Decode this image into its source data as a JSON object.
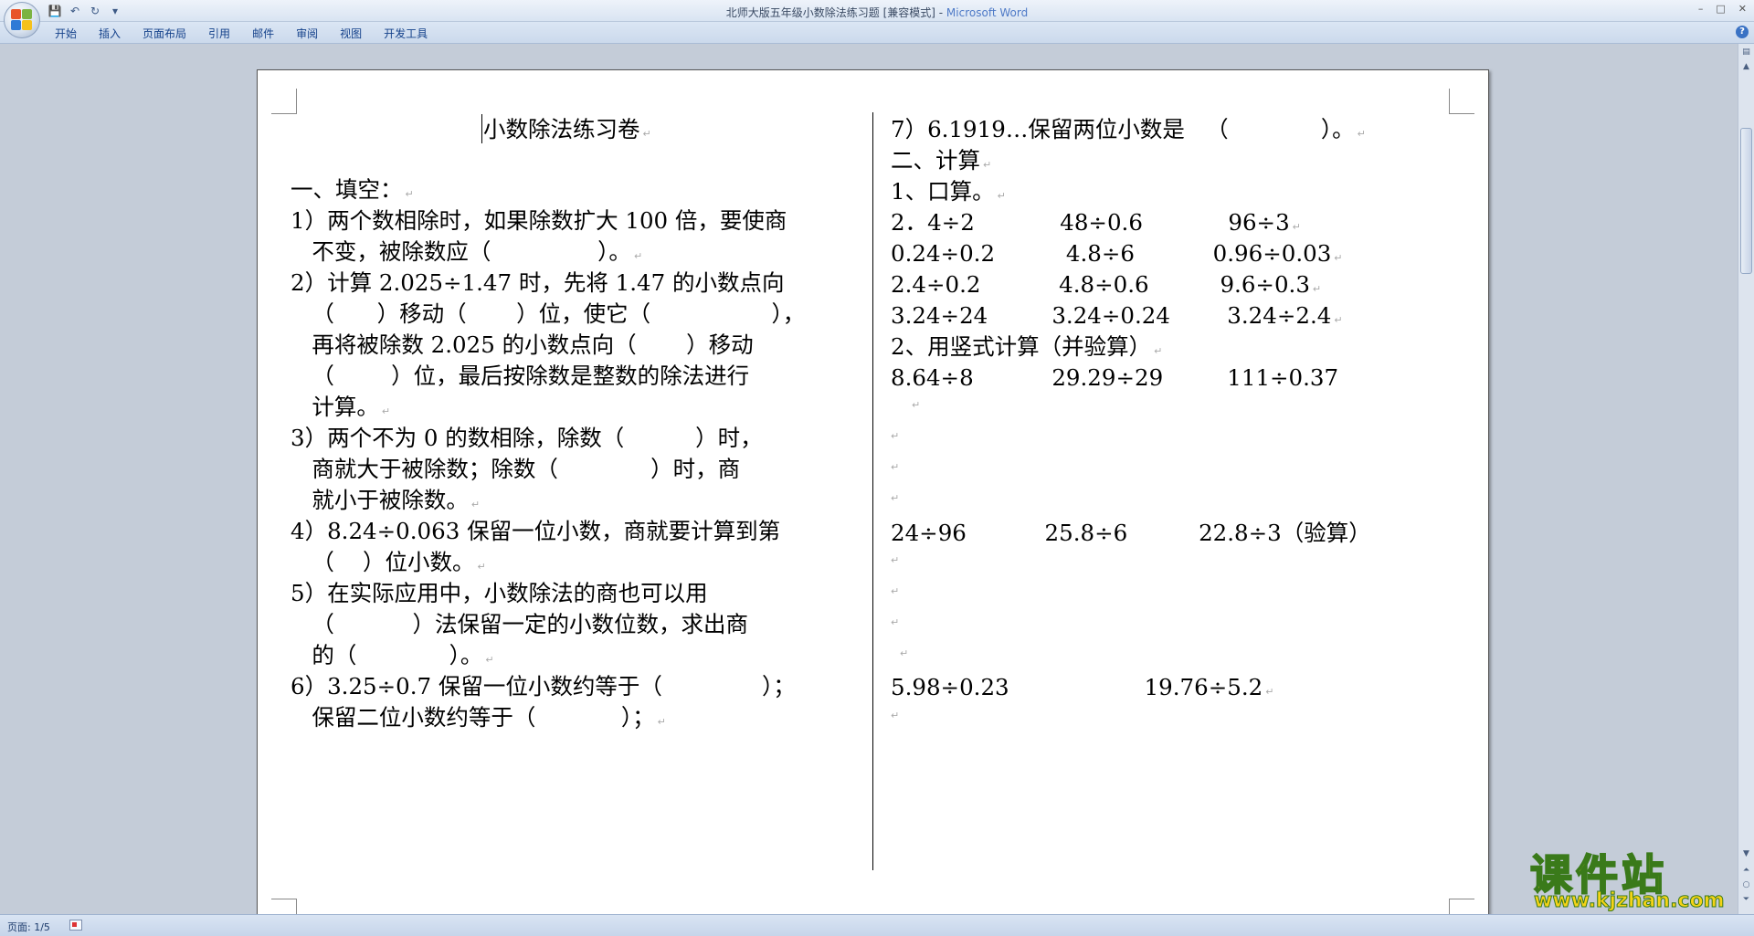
{
  "window": {
    "title_doc": "北师大版五年级小数除法练习题 [兼容模式] - ",
    "title_app": "Microsoft Word",
    "controls": [
      "–",
      "□",
      "✕"
    ]
  },
  "ribbon": {
    "tabs": [
      "开始",
      "插入",
      "页面布局",
      "引用",
      "邮件",
      "审阅",
      "视图",
      "开发工具"
    ],
    "help": "?"
  },
  "document": {
    "title": "小数除法练习卷",
    "left_lines": [
      "一、填空：",
      "1）两个数相除时，如果除数扩大 100 倍，要使商",
      "   不变，被除数应（               ）。",
      "2）计算 2.025÷1.47 时，先将 1.47 的小数点向",
      "   （      ）移动（       ）位，使它（                 ），",
      "   再将被除数 2.025 的小数点向（       ）移动",
      "   （        ）位，最后按除数是整数的除法进行",
      "   计算。",
      "3）两个不为 0 的数相除，除数（          ）时，",
      "   商就大于被除数；除数（             ）时，商",
      "   就小于被除数。",
      "4）8.24÷0.063 保留一位小数，商就要计算到第",
      "   （    ）位小数。",
      "5）在实际应用中，小数除法的商也可以用",
      "   （           ）法保留一定的小数位数，求出商",
      "   的（             ）。",
      "6）3.25÷0.7 保留一位小数约等于（              ）；",
      "   保留二位小数约等于（            ）；"
    ],
    "right_lines": [
      "7）6.1919…保留两位小数是   （             ）。",
      "二、计算",
      "1、口算。",
      "2．4÷2            48÷0.6            96÷3",
      "0.24÷0.2          4.8÷6           0.96÷0.03",
      "2.4÷0.2           4.8÷0.6          9.6÷0.3",
      "3.24÷24         3.24÷0.24        3.24÷2.4",
      "2、用竖式计算（并验算）",
      "8.64÷8           29.29÷29         111÷0.37",
      "24÷96           25.8÷6          22.8÷3（验算）",
      "5.98÷0.23                   19.76÷5.2"
    ],
    "paragraph_mark": "↵"
  },
  "status": {
    "page": "页面: 1/5"
  },
  "watermark": {
    "name": "课件站",
    "url": "www.kjzhan.com"
  },
  "colors": {
    "ribbon_text": "#15428b",
    "title_app": "#4e7ac7",
    "watermark_fill": "#f5d316",
    "watermark_stroke": "#3a7a1a"
  }
}
